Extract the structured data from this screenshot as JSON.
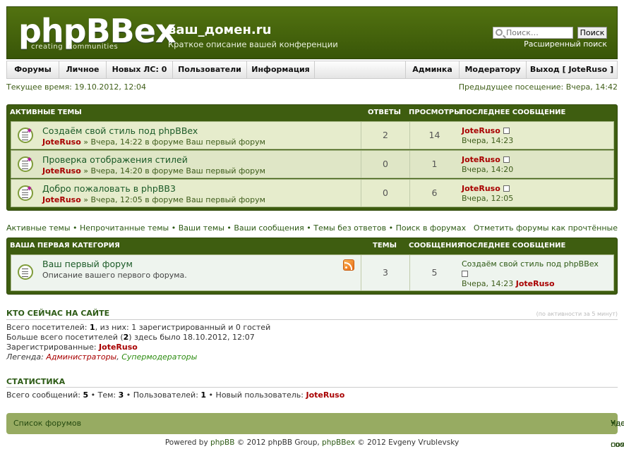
{
  "header": {
    "logo": "phpBBex",
    "logo_sub1": "creating",
    "logo_sub2": "communities",
    "site_name": "ваш_домен.ru",
    "site_desc": "Краткое описание вашей конференции",
    "search_placeholder": "Поиск…",
    "search_button": "Поиск",
    "advanced_search": "Расширенный поиск"
  },
  "nav": {
    "left": [
      "Форумы",
      "Личное",
      "Новых ЛС: 0",
      "Пользователи",
      "Информация"
    ],
    "right": [
      "Админка",
      "Модератору",
      "Выход [ JoteRuso ]"
    ]
  },
  "time": {
    "current": "Текущее время: 19.10.2012, 12:04",
    "last_visit": "Предыдущее посещение: Вчера, 14:42"
  },
  "active": {
    "title": "Активные темы",
    "col_replies": "Ответы",
    "col_views": "Просмотры",
    "col_last": "Последнее сообщение",
    "topics": [
      {
        "title": "Создаём свой стиль под phpBBex",
        "author": "JoteRuso",
        "meta": " » Вчера, 14:22 в форуме Ваш первый форум",
        "replies": "2",
        "views": "14",
        "last_author": "JoteRuso",
        "last_time": "Вчера, 14:23"
      },
      {
        "title": "Проверка отображения стилей",
        "author": "JoteRuso",
        "meta": " » Вчера, 14:20 в форуме Ваш первый форум",
        "replies": "0",
        "views": "1",
        "last_author": "JoteRuso",
        "last_time": "Вчера, 14:20"
      },
      {
        "title": "Добро пожаловать в phpBB3",
        "author": "JoteRuso",
        "meta": " » Вчера, 12:05 в форуме Ваш первый форум",
        "replies": "0",
        "views": "6",
        "last_author": "JoteRuso",
        "last_time": "Вчера, 12:05"
      }
    ]
  },
  "quick_links": [
    "Активные темы",
    "Непрочитанные темы",
    "Ваши темы",
    "Ваши сообщения",
    "Темы без ответов",
    "Поиск в форумах"
  ],
  "mark_read": "Отметить форумы как прочтённые",
  "category": {
    "title": "Ваша первая категория",
    "col_topics": "Темы",
    "col_posts": "Сообщения",
    "col_last": "Последнее сообщение",
    "forum": {
      "name": "Ваш первый форум",
      "desc": "Описание вашего первого форума.",
      "topics": "3",
      "posts": "5",
      "last_topic": "Создаём свой стиль под phpBBex",
      "last_time": "Вчера, 14:23",
      "last_author": "JoteRuso"
    }
  },
  "online": {
    "title": "Кто сейчас на сайте",
    "note": "(по активности за 5 минут)",
    "l1a": "Всего посетителей: ",
    "l1b": "1",
    "l1c": ", из них: 1 зарегистрированный и 0 гостей",
    "l2a": "Больше всего посетителей (",
    "l2b": "2",
    "l2c": ") здесь было 18.10.2012, 12:07",
    "l3a": "Зарегистрированные: ",
    "l3b": "JoteRuso",
    "l4a": "Легенда: ",
    "l4b": "Администраторы",
    "l4c": ", ",
    "l4d": "Супермодераторы"
  },
  "stats": {
    "title": "Статистика",
    "a": "Всего сообщений: ",
    "b": "5",
    "c": " • Тем: ",
    "d": "3",
    "e": " • Пользователей: ",
    "f": "1",
    "g": " • Новый пользователь: ",
    "h": "JoteRuso"
  },
  "footer": {
    "index": "Список форумов",
    "delete_cookies": "Удалить cookies конференции",
    "sep": " • ",
    "timezone": "Часовой пояс: UTC"
  },
  "copyright": {
    "a": "Powered by ",
    "b": "phpBB",
    "c": " © 2012 phpBB Group, ",
    "d": "phpBBex",
    "e": " © 2012 Evgeny Vrublevsky"
  }
}
